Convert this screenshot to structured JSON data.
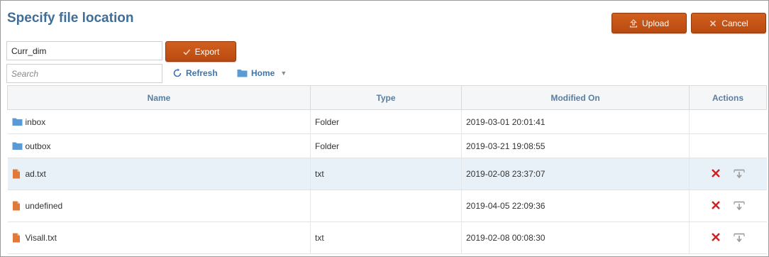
{
  "title": "Specify file location",
  "buttons": {
    "upload": "Upload",
    "cancel": "Cancel",
    "export": "Export"
  },
  "filename_input": {
    "value": "Curr_dim",
    "placeholder": ""
  },
  "search_input": {
    "value": "",
    "placeholder": "Search"
  },
  "toolbar": {
    "refresh": "Refresh",
    "home": "Home"
  },
  "table": {
    "columns": [
      "Name",
      "Type",
      "Modified On",
      "Actions"
    ],
    "rows": [
      {
        "name": "inbox",
        "kind": "folder",
        "type": "Folder",
        "modified": "2019-03-01 20:01:41",
        "actions": false
      },
      {
        "name": "outbox",
        "kind": "folder",
        "type": "Folder",
        "modified": "2019-03-21 19:08:55",
        "actions": false
      },
      {
        "name": "ad.txt",
        "kind": "file",
        "type": "txt",
        "modified": "2019-02-08 23:37:07",
        "actions": true,
        "selected": true
      },
      {
        "name": "undefined",
        "kind": "file",
        "type": "",
        "modified": "2019-04-05 22:09:36",
        "actions": true
      },
      {
        "name": "Visall.txt",
        "kind": "file",
        "type": "txt",
        "modified": "2019-02-08 00:08:30",
        "actions": true
      }
    ]
  },
  "colors": {
    "title": "#3f6e98",
    "button": "#c5561a",
    "link": "#3a74b0",
    "folder_icon": "#5b9bd5",
    "file_icon": "#e07a3a",
    "delete_icon": "#d21f1f",
    "selected_row": "#e8f1f8"
  },
  "icons": {
    "upload": "upload-icon",
    "cancel": "close-icon",
    "export": "checkmark-icon",
    "refresh": "refresh-icon",
    "home": "folder-icon",
    "delete": "delete-x-icon",
    "download": "download-icon"
  }
}
